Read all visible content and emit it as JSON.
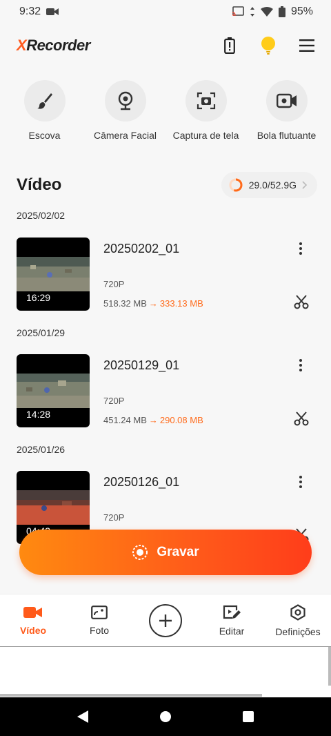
{
  "status": {
    "time": "9:32",
    "battery": "95%"
  },
  "app": {
    "logo_x": "X",
    "logo_rest": "Recorder"
  },
  "tools": [
    {
      "label": "Escova",
      "icon": "brush-icon"
    },
    {
      "label": "Câmera Facial",
      "icon": "webcam-icon"
    },
    {
      "label": "Captura de tela",
      "icon": "screenshot-icon"
    },
    {
      "label": "Bola flutuante",
      "icon": "floating-ball-icon"
    }
  ],
  "section": {
    "title": "Vídeo",
    "storage": "29.0/52.9G",
    "storage_used_fraction": 0.55
  },
  "groups": [
    {
      "date": "2025/02/02",
      "video": {
        "title": "20250202_01",
        "duration": "16:29",
        "resolution": "720P",
        "size_original": "518.32 MB",
        "size_compressed": "333.13 MB"
      }
    },
    {
      "date": "2025/01/29",
      "video": {
        "title": "20250129_01",
        "duration": "14:28",
        "resolution": "720P",
        "size_original": "451.24 MB",
        "size_compressed": "290.08 MB"
      }
    },
    {
      "date": "2025/01/26",
      "video": {
        "title": "20250126_01",
        "duration": "04:43",
        "resolution": "720P"
      }
    }
  ],
  "record_button": {
    "label": "Gravar"
  },
  "nav": {
    "video": "Vídeo",
    "photo": "Foto",
    "edit": "Editar",
    "settings": "Definições"
  },
  "colors": {
    "accent": "#ff5a1a",
    "accent_light": "#ff8a10"
  }
}
